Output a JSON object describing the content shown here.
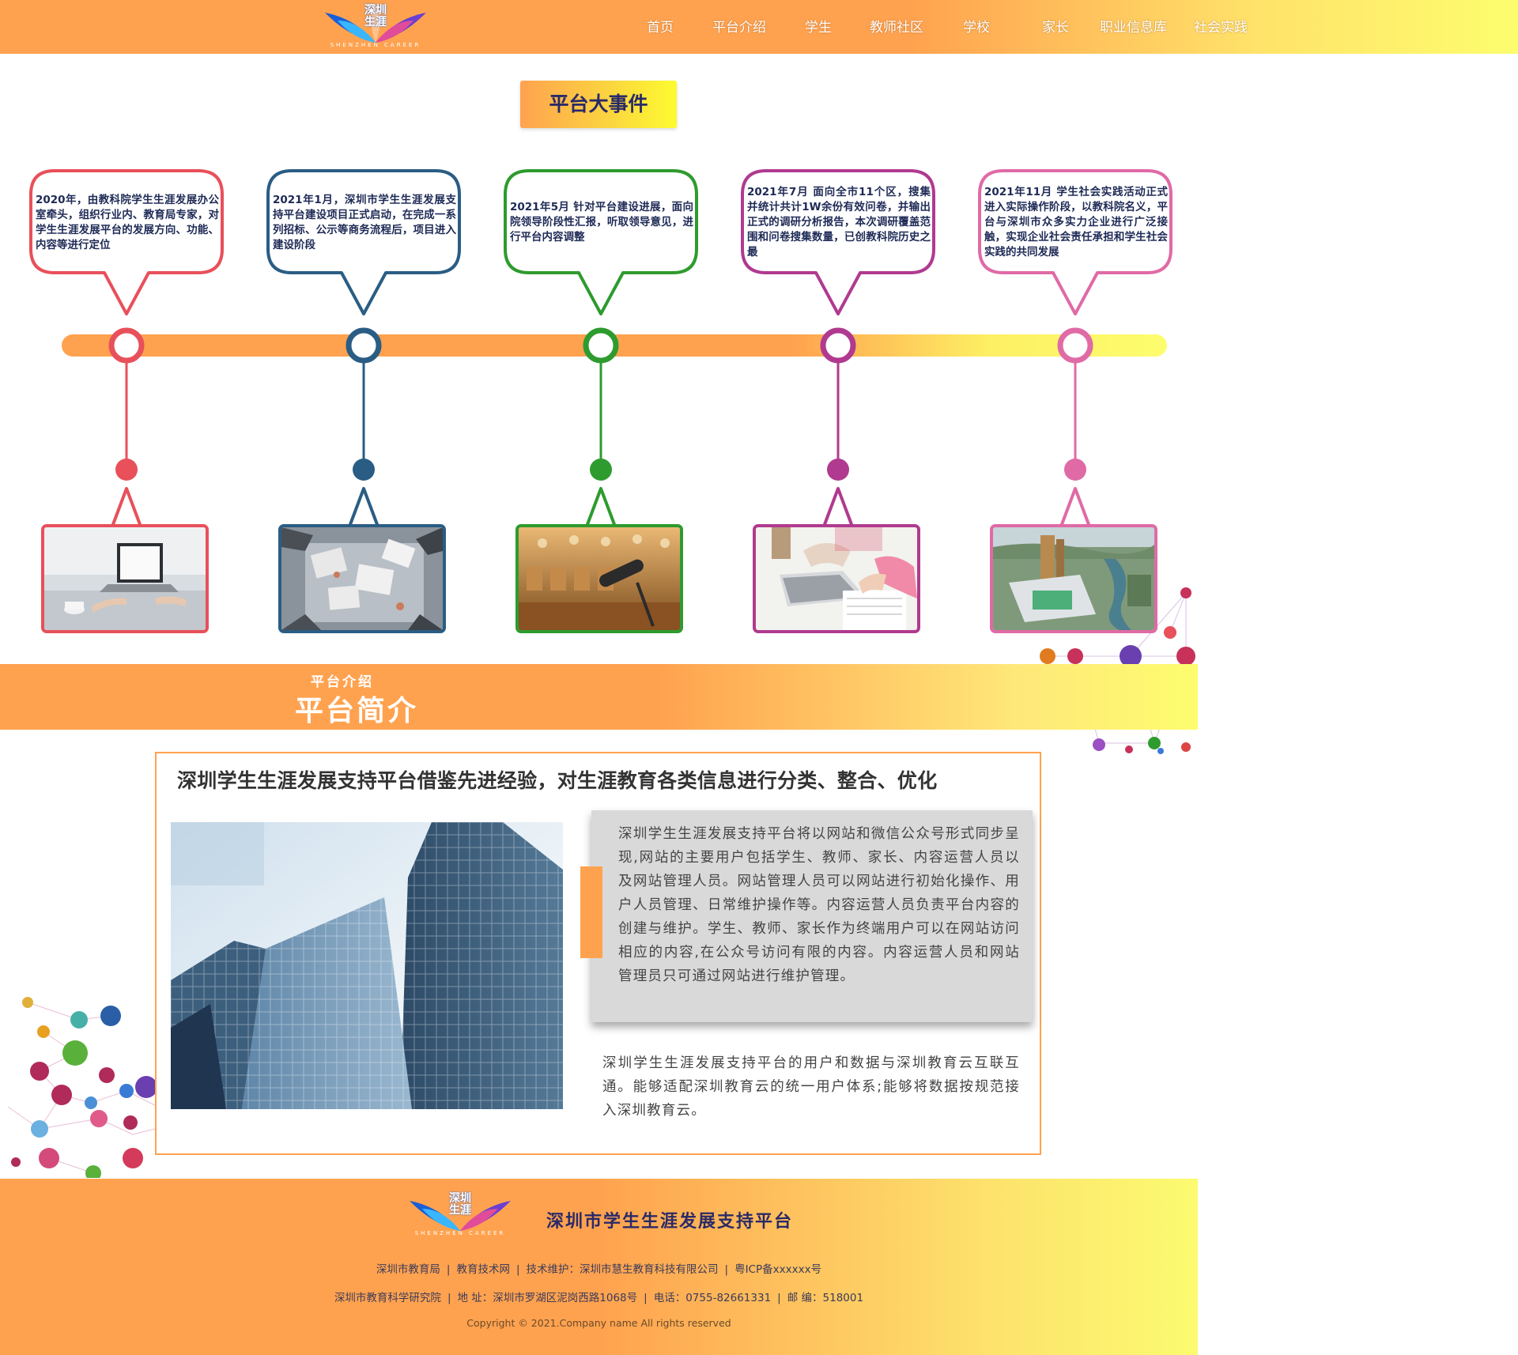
{
  "brand": {
    "logo_cn_line1": "深圳",
    "logo_cn_line2": "生涯",
    "logo_en": "SHENZHEN CAREER"
  },
  "nav": {
    "items": [
      "首页",
      "平台介绍",
      "学生",
      "教师社区",
      "学校",
      "家长",
      "职业信息库",
      "社会实践"
    ]
  },
  "events": {
    "title": "平台大事件",
    "items": [
      {
        "text": "2020年，由教科院学生生涯发展办公室牵头，组织行业内、教育局专家，对学生生涯发展平台的发展方向、功能、内容等进行定位",
        "color": "#e8505a",
        "photo_icon": "laptop-desk-photo"
      },
      {
        "text": "2021年1月，深圳市学生生涯发展支持平台建设项目正式启动，在完成一系列招标、公示等商务流程后，项目进入建设阶段",
        "color": "#2a5d84",
        "photo_icon": "team-meeting-photo"
      },
      {
        "text": "2021年5月 针对平台建设进展，面向院领导阶段性汇报，听取领导意见，进行平台内容调整",
        "color": "#2e9b2e",
        "photo_icon": "conference-microphone-photo"
      },
      {
        "text": "2021年7月 面向全市11个区，搜集并统计共计1W余份有效问卷，并输出正式的调研分析报告，本次调研覆盖范围和问卷搜集数量，已创教科院历史之最",
        "color": "#b03a8f",
        "photo_icon": "survey-writing-photo"
      },
      {
        "text": "2021年11月 学生社会实践活动正式进入实际操作阶段，以教科院名义，平台与深圳市众多实力企业进行广泛接触，实现企业社会责任承担和学生社会实践的共同发展",
        "color": "#e06aa6",
        "photo_icon": "campus-aerial-photo"
      }
    ]
  },
  "intro": {
    "subtitle": "平台介绍",
    "title": "平台简介",
    "headline": "深圳学生生涯发展支持平台借鉴先进经验，对生涯教育各类信息进行分类、整合、优化",
    "paragraph1": "深圳学生生涯发展支持平台将以网站和微信公众号形式同步呈现,网站的主要用户包括学生、教师、家长、内容运营人员以及网站管理人员。网站管理人员可以网站进行初始化操作、用户人员管理、日常维护操作等。内容运营人员负责平台内容的创建与维护。学生、教师、家长作为终端用户可以在网站访问相应的内容,在公众号访问有限的内容。内容运营人员和网站管理员只可通过网站进行维护管理。",
    "paragraph2": "深圳学生生涯发展支持平台的用户和数据与深圳教育云互联互通。能够适配深圳教育云的统一用户体系;能够将数据按规范接入深圳教育云。",
    "image_icon": "office-building-photo"
  },
  "footer": {
    "platform_name": "深圳市学生生涯发展支持平台",
    "row1": [
      "深圳市教育局",
      "教育技术网",
      "技术维护：深圳市慧生教育科技有限公司",
      "粤ICP备xxxxxx号"
    ],
    "row2": [
      "深圳市教育科学研究院",
      "地  址：深圳市罗湖区泥岗西路1068号",
      "电话：0755-82661331",
      "邮  编：518001"
    ],
    "copyright": "Copyright © 2021.Company name All rights reserved"
  },
  "colors": {
    "orange": "#ffa24f",
    "yellow": "#fdfd6e",
    "navy_text": "#2a2a68"
  }
}
